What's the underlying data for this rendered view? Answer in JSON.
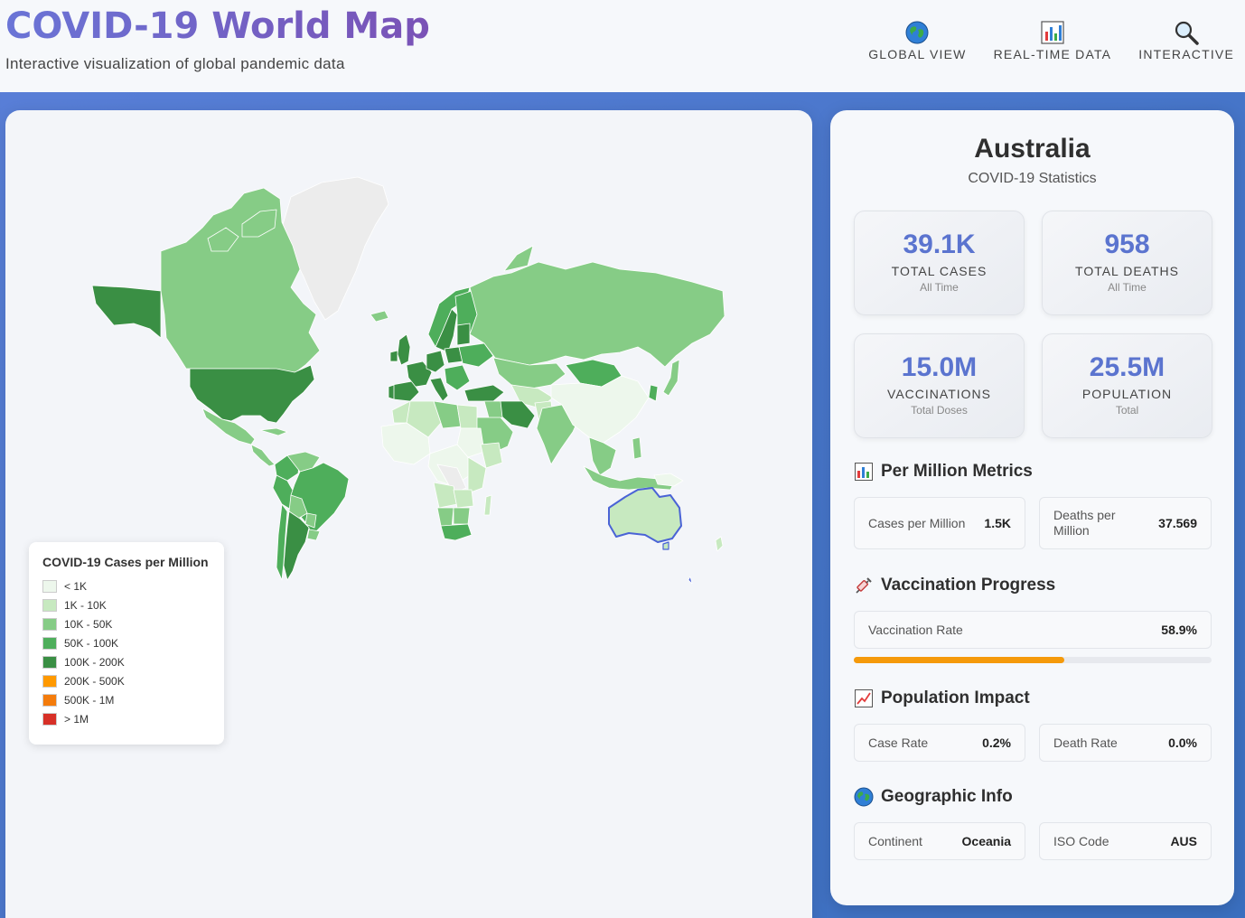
{
  "header": {
    "title": "COVID-19 World Map",
    "subtitle": "Interactive visualization of global pandemic data",
    "nav": [
      {
        "label": "GLOBAL VIEW",
        "icon": "globe-icon"
      },
      {
        "label": "REAL-TIME DATA",
        "icon": "bar-chart-icon"
      },
      {
        "label": "INTERACTIVE",
        "icon": "magnifier-icon"
      }
    ]
  },
  "map": {
    "selected_country": "Australia",
    "legend": {
      "title": "COVID-19 Cases per Million",
      "items": [
        {
          "label": "< 1K",
          "color": "#edf7ec"
        },
        {
          "label": "1K - 10K",
          "color": "#c7e9c0"
        },
        {
          "label": "10K - 50K",
          "color": "#86cc86"
        },
        {
          "label": "50K - 100K",
          "color": "#4eae5b"
        },
        {
          "label": "100K - 200K",
          "color": "#3a8f44"
        },
        {
          "label": "200K - 500K",
          "color": "#ff9900"
        },
        {
          "label": "500K - 1M",
          "color": "#f47c0c"
        },
        {
          "label": "> 1M",
          "color": "#d73027"
        }
      ]
    }
  },
  "stats": {
    "country": "Australia",
    "subtitle": "COVID-19 Statistics",
    "cards": [
      {
        "value": "39.1K",
        "label": "TOTAL CASES",
        "sub": "All Time"
      },
      {
        "value": "958",
        "label": "TOTAL DEATHS",
        "sub": "All Time"
      },
      {
        "value": "15.0M",
        "label": "VACCINATIONS",
        "sub": "Total Doses"
      },
      {
        "value": "25.5M",
        "label": "POPULATION",
        "sub": "Total"
      }
    ],
    "per_million": {
      "title": "Per Million Metrics",
      "cases_label": "Cases per Million",
      "cases_value": "1.5K",
      "deaths_label": "Deaths per Million",
      "deaths_value": "37.569"
    },
    "vaccination": {
      "title": "Vaccination Progress",
      "rate_label": "Vaccination Rate",
      "rate_value": "58.9%",
      "rate_fraction": 0.589,
      "bar_color": "#f59a0b"
    },
    "population_impact": {
      "title": "Population Impact",
      "case_rate_label": "Case Rate",
      "case_rate_value": "0.2%",
      "death_rate_label": "Death Rate",
      "death_rate_value": "0.0%"
    },
    "geographic": {
      "title": "Geographic Info",
      "continent_label": "Continent",
      "continent_value": "Oceania",
      "iso_label": "ISO Code",
      "iso_value": "AUS"
    }
  },
  "colors": {
    "accent": "#5b74cf",
    "highlight_outline": "#4a63d6"
  }
}
